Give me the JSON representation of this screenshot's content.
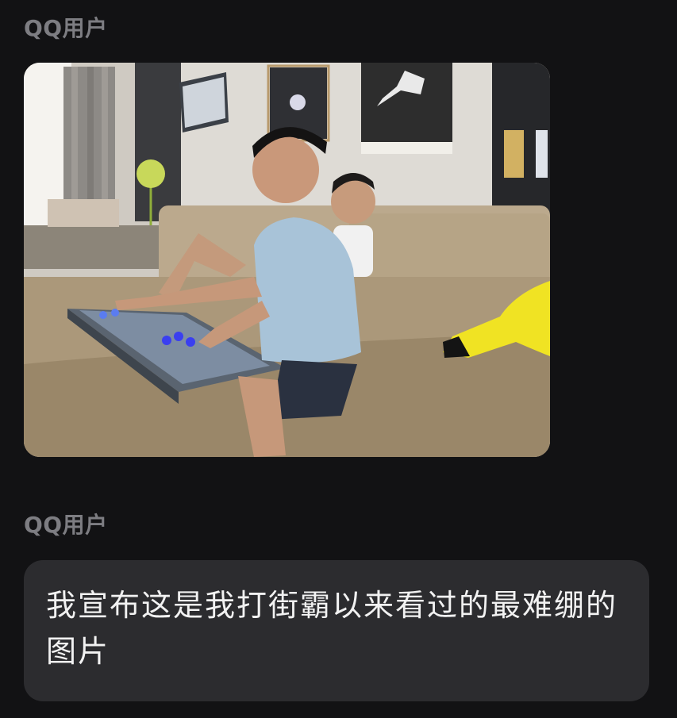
{
  "messages": [
    {
      "sender": "QQ用户",
      "type": "image",
      "image_icon": "photo-kids-arcade-stick-sofa"
    },
    {
      "sender": "QQ用户",
      "type": "text",
      "text": "我宣布这是我打街霸以来看过的最难绷的图片"
    }
  ],
  "colors": {
    "background": "#121214",
    "sender_name": "#7d7d82",
    "text_bubble": "#2c2c2f",
    "text": "#f2f2f2"
  }
}
